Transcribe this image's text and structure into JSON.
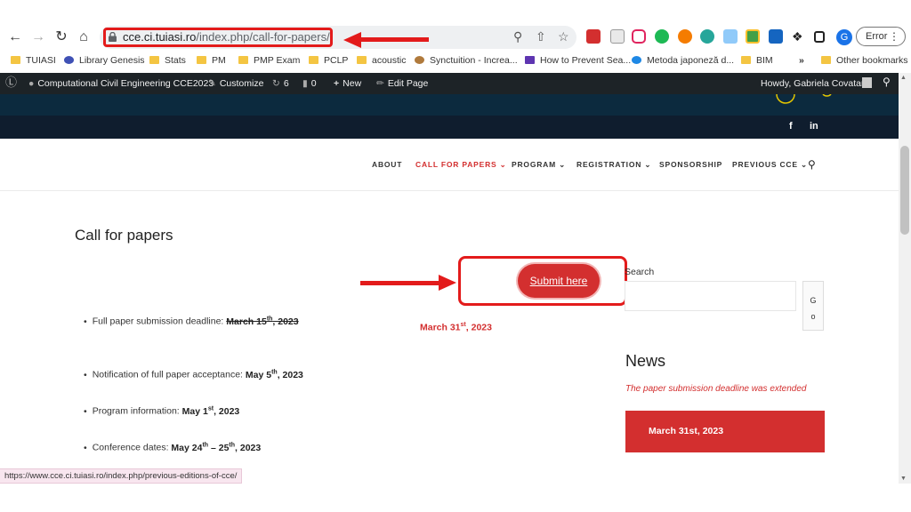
{
  "browser": {
    "url_host": "cce.ci.tuiasi.ro",
    "url_path": "/index.php/call-for-papers/",
    "profile_initial": "G",
    "error_label": "Error",
    "accent": "#e31b1b"
  },
  "bookmarks": {
    "items": [
      "TUIASI",
      "Library Genesis",
      "Stats",
      "PM",
      "PMP Exam",
      "PCLP",
      "acoustic",
      "Synctuition - Increa...",
      "How to Prevent Sea...",
      "Metoda japoneză d...",
      "BIM"
    ],
    "more": "»",
    "other": "Other bookmarks"
  },
  "adminbar": {
    "site": "Computational Civil Engineering CCE2023",
    "customize": "Customize",
    "updates": "6",
    "comments": "0",
    "new": "New",
    "edit": "Edit Page",
    "howdy": "Howdy, Gabriela Covatariu"
  },
  "social": {
    "facebook": "f",
    "linkedin": "in"
  },
  "menu": {
    "about": "ABOUT",
    "call": "CALL FOR PAPERS",
    "program": "PROGRAM",
    "registration": "REGISTRATION",
    "sponsorship": "SPONSORSHIP",
    "previous": "PREVIOUS CCE",
    "active_color": "#d32f2f"
  },
  "page": {
    "title": "Call for papers",
    "submit_label": "Submit here",
    "deadline_label": "Full paper submission deadline:",
    "deadline_old_day": "March 15",
    "deadline_old_sup": "th",
    "deadline_old_year": ", 2023",
    "deadline_new_day": "March 31",
    "deadline_new_sup": "st",
    "deadline_new_year": ", 2023",
    "acceptance_label": "Notification of full paper acceptance:",
    "acceptance_day": "May 5",
    "acceptance_sup": "th",
    "acceptance_year": ", 2023",
    "program_label": "Program information:",
    "program_day": "May 1",
    "program_sup": "st",
    "program_year": ", 2023",
    "conference_label": "Conference dates:",
    "conference_start": "May 24",
    "conference_start_sup": "th",
    "conference_dash": " – 25",
    "conference_end_sup": "th",
    "conference_year": ", 2023"
  },
  "sidebar": {
    "search_label": "Search",
    "go_label_1": "G",
    "go_label_2": "o",
    "news_title": "News",
    "news_text": "The paper submission deadline was extended",
    "news_card": "March 31st, 2023"
  },
  "status": {
    "url": "https://www.cce.ci.tuiasi.ro/index.php/previous-editions-of-cce/"
  }
}
